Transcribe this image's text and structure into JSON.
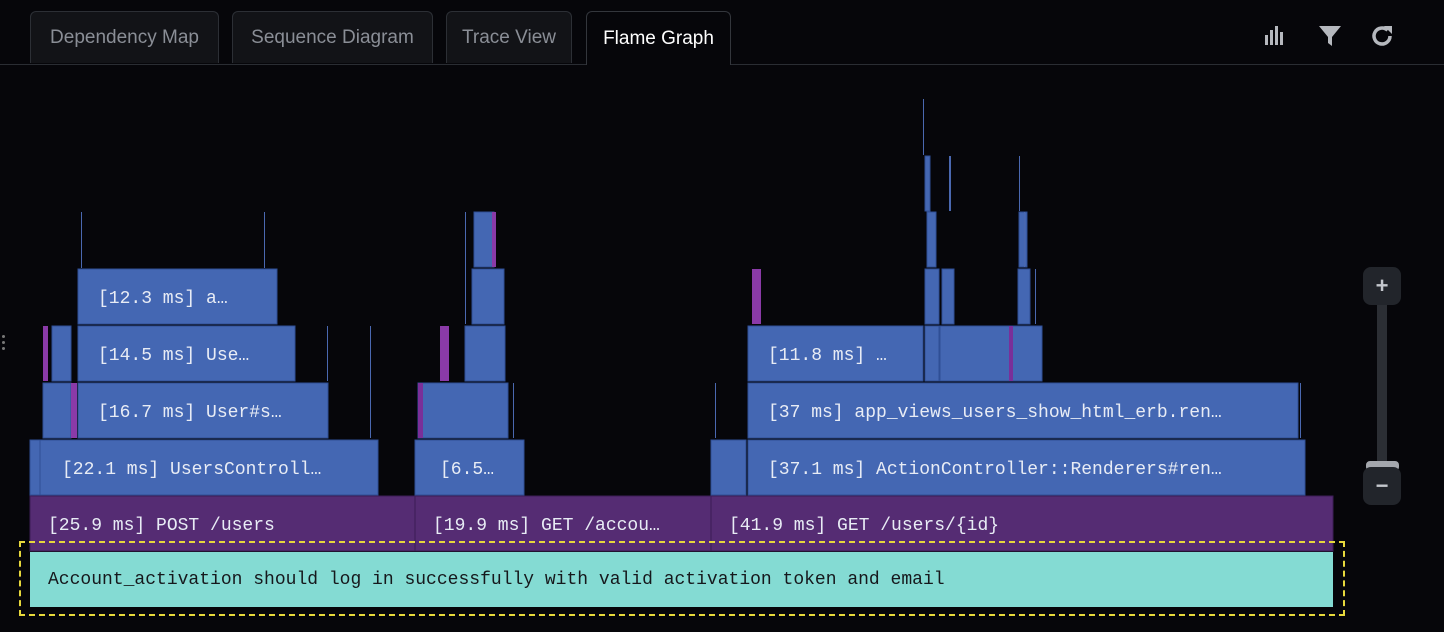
{
  "tabs": [
    {
      "label": "Dependency Map",
      "active": false
    },
    {
      "label": "Sequence Diagram",
      "active": false
    },
    {
      "label": "Trace View",
      "active": false
    },
    {
      "label": "Flame Graph",
      "active": true
    }
  ],
  "toolbar": {
    "icons": [
      "bar-chart-icon",
      "filter-icon",
      "refresh-icon"
    ]
  },
  "zoom": {
    "in_label": "+",
    "out_label": "−"
  },
  "flame": {
    "root_label": "Account_activation should log in successfully with valid activation token and email",
    "frames": {
      "post_users": "[25.9 ms] POST /users",
      "get_account": "[19.9 ms] GET /accou…",
      "get_users_id": "[41.9 ms] GET /users/{id}",
      "users_controller": "[22.1 ms] UsersControll…",
      "user_s": "[16.7 ms] User#s…",
      "use": "[14.5 ms] Use…",
      "a": "[12.3 ms] a…",
      "six_five": "[6.5…",
      "renderers": "[37.1 ms] ActionController::Renderers#ren…",
      "app_views": "[37 ms] app_views_users_show_html_erb.ren…",
      "eleven_eight": "[11.8 ms] …"
    }
  },
  "colors": {
    "frame_blue": "#4467b3",
    "frame_purple": "#552c73",
    "selected": "#84dbd3",
    "highlight": "#e6d83c"
  }
}
